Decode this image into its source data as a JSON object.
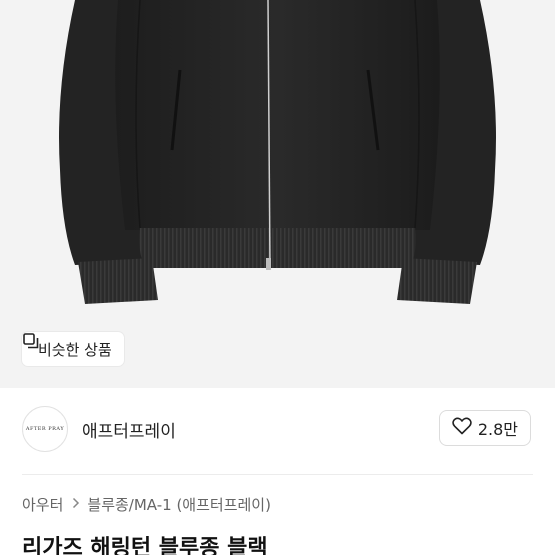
{
  "hero": {
    "image": "black-bomber-jacket-photo",
    "background": "#f3f3f3",
    "jacket_color": "#222222"
  },
  "similar_button": {
    "icon": "similar-items-icon",
    "label": "비슷한 상품"
  },
  "store": {
    "logo_text": "AFTER PRAY",
    "name": "애프터프레이",
    "like_icon": "heart-outline-icon",
    "like_count": "2.8만"
  },
  "breadcrumb": {
    "items": [
      "아우터",
      "블루종/MA-1 (애프터프레이)"
    ],
    "separator_icon": "chevron-right-icon"
  },
  "product": {
    "title": "리가즈 해링턴 블루종 블랙"
  }
}
